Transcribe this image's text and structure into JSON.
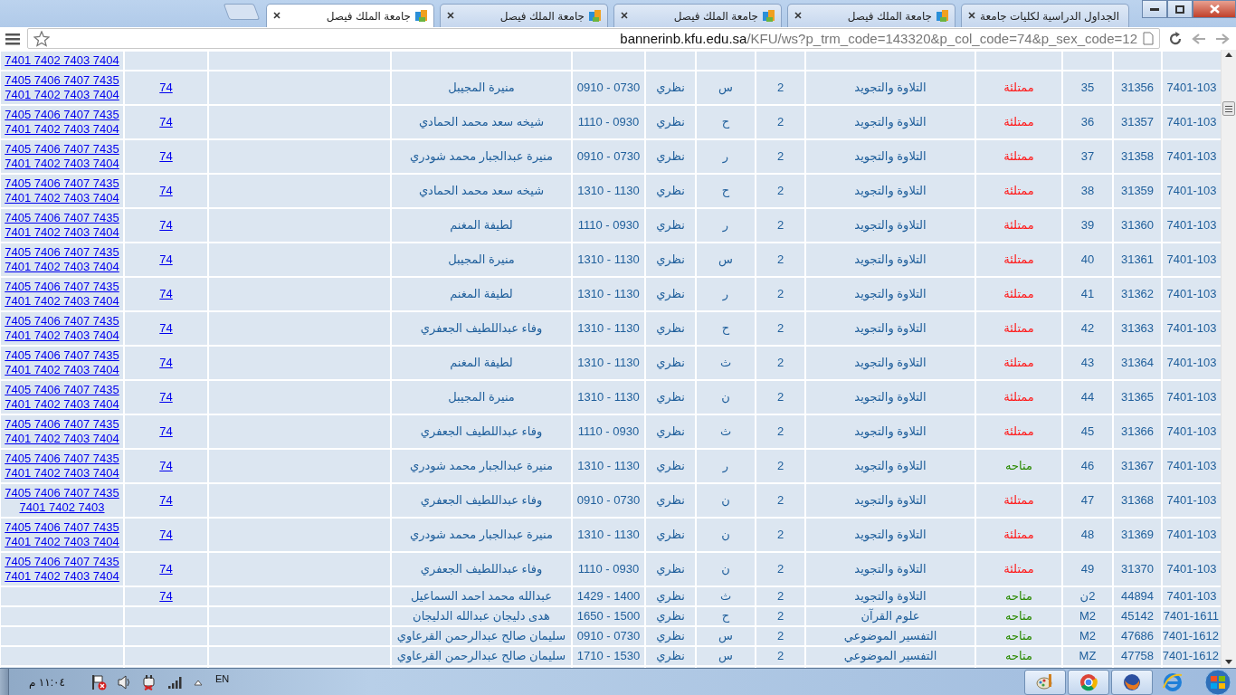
{
  "browser": {
    "tabs": [
      {
        "title": "الجداول الدراسية لكليات جامعة",
        "selected": false,
        "kind": "kfu"
      },
      {
        "title": "جامعة الملك فيصل",
        "selected": false,
        "kind": "site"
      },
      {
        "title": "جامعة الملك فيصل",
        "selected": false,
        "kind": "site"
      },
      {
        "title": "جامعة الملك فيصل",
        "selected": false,
        "kind": "site"
      },
      {
        "title": "جامعة الملك فيصل",
        "selected": true,
        "kind": "site"
      }
    ],
    "address_bar": {
      "host": "bannerinb.kfu.edu.sa",
      "path": "/KFU/ws?p_trm_code=143320&p_col_code=74&p_sex_code=12"
    }
  },
  "table": {
    "rows": [
      {
        "majors": [
          "7401 7402 7403 7404"
        ]
      },
      {
        "code": "7401-103",
        "crn": "31356",
        "section": "35",
        "status": "ممتلئة",
        "full": true,
        "course": "التلاوة والتجويد",
        "hours": "2",
        "day": "س",
        "type": "نظري",
        "time": "0910 - 0730",
        "instructor": "منيرة المجيبل",
        "college": "74",
        "majors": [
          "7405 7406 7407 7435",
          "7401 7402 7403 7404"
        ]
      },
      {
        "code": "7401-103",
        "crn": "31357",
        "section": "36",
        "status": "ممتلئة",
        "full": true,
        "course": "التلاوة والتجويد",
        "hours": "2",
        "day": "ح",
        "type": "نظري",
        "time": "1110 - 0930",
        "instructor": "شيخه سعد محمد الحمادي",
        "college": "74",
        "majors": [
          "7405 7406 7407 7435",
          "7401 7402 7403 7404"
        ]
      },
      {
        "code": "7401-103",
        "crn": "31358",
        "section": "37",
        "status": "ممتلئة",
        "full": true,
        "course": "التلاوة والتجويد",
        "hours": "2",
        "day": "ر",
        "type": "نظري",
        "time": "0910 - 0730",
        "instructor": "منيرة عبدالجبار محمد شودري",
        "college": "74",
        "majors": [
          "7405 7406 7407 7435",
          "7401 7402 7403 7404"
        ]
      },
      {
        "code": "7401-103",
        "crn": "31359",
        "section": "38",
        "status": "ممتلئة",
        "full": true,
        "course": "التلاوة والتجويد",
        "hours": "2",
        "day": "ح",
        "type": "نظري",
        "time": "1310 - 1130",
        "instructor": "شيخه سعد محمد الحمادي",
        "college": "74",
        "majors": [
          "7405 7406 7407 7435",
          "7401 7402 7403 7404"
        ]
      },
      {
        "code": "7401-103",
        "crn": "31360",
        "section": "39",
        "status": "ممتلئة",
        "full": true,
        "course": "التلاوة والتجويد",
        "hours": "2",
        "day": "ر",
        "type": "نظري",
        "time": "1110 - 0930",
        "instructor": "لطيفة المغنم",
        "college": "74",
        "majors": [
          "7405 7406 7407 7435",
          "7401 7402 7403 7404"
        ]
      },
      {
        "code": "7401-103",
        "crn": "31361",
        "section": "40",
        "status": "ممتلئة",
        "full": true,
        "course": "التلاوة والتجويد",
        "hours": "2",
        "day": "س",
        "type": "نظري",
        "time": "1310 - 1130",
        "instructor": "منيرة المجيبل",
        "college": "74",
        "majors": [
          "7405 7406 7407 7435",
          "7401 7402 7403 7404"
        ]
      },
      {
        "code": "7401-103",
        "crn": "31362",
        "section": "41",
        "status": "ممتلئة",
        "full": true,
        "course": "التلاوة والتجويد",
        "hours": "2",
        "day": "ر",
        "type": "نظري",
        "time": "1310 - 1130",
        "instructor": "لطيفة المغنم",
        "college": "74",
        "majors": [
          "7405 7406 7407 7435",
          "7401 7402 7403 7404"
        ]
      },
      {
        "code": "7401-103",
        "crn": "31363",
        "section": "42",
        "status": "ممتلئة",
        "full": true,
        "course": "التلاوة والتجويد",
        "hours": "2",
        "day": "ح",
        "type": "نظري",
        "time": "1310 - 1130",
        "instructor": "وفاء عبداللطيف الجعفري",
        "college": "74",
        "majors": [
          "7405 7406 7407 7435",
          "7401 7402 7403 7404"
        ]
      },
      {
        "code": "7401-103",
        "crn": "31364",
        "section": "43",
        "status": "ممتلئة",
        "full": true,
        "course": "التلاوة والتجويد",
        "hours": "2",
        "day": "ث",
        "type": "نظري",
        "time": "1310 - 1130",
        "instructor": "لطيفة المغنم",
        "college": "74",
        "majors": [
          "7405 7406 7407 7435",
          "7401 7402 7403 7404"
        ]
      },
      {
        "code": "7401-103",
        "crn": "31365",
        "section": "44",
        "status": "ممتلئة",
        "full": true,
        "course": "التلاوة والتجويد",
        "hours": "2",
        "day": "ن",
        "type": "نظري",
        "time": "1310 - 1130",
        "instructor": "منيرة المجيبل",
        "college": "74",
        "majors": [
          "7405 7406 7407 7435",
          "7401 7402 7403 7404"
        ]
      },
      {
        "code": "7401-103",
        "crn": "31366",
        "section": "45",
        "status": "ممتلئة",
        "full": true,
        "course": "التلاوة والتجويد",
        "hours": "2",
        "day": "ث",
        "type": "نظري",
        "time": "1110 - 0930",
        "instructor": "وفاء عبداللطيف الجعفري",
        "college": "74",
        "majors": [
          "7405 7406 7407 7435",
          "7401 7402 7403 7404"
        ]
      },
      {
        "code": "7401-103",
        "crn": "31367",
        "section": "46",
        "status": "متاحه",
        "full": false,
        "course": "التلاوة والتجويد",
        "hours": "2",
        "day": "ر",
        "type": "نظري",
        "time": "1310 - 1130",
        "instructor": "منيرة عبدالجبار محمد شودري",
        "college": "74",
        "majors": [
          "7405 7406 7407 7435",
          "7401 7402 7403 7404"
        ]
      },
      {
        "code": "7401-103",
        "crn": "31368",
        "section": "47",
        "status": "ممتلئة",
        "full": true,
        "course": "التلاوة والتجويد",
        "hours": "2",
        "day": "ن",
        "type": "نظري",
        "time": "0910 - 0730",
        "instructor": "وفاء عبداللطيف الجعفري",
        "college": "74",
        "majors": [
          "7405 7406 7407 7435",
          "7401 7402 7403"
        ]
      },
      {
        "code": "7401-103",
        "crn": "31369",
        "section": "48",
        "status": "ممتلئة",
        "full": true,
        "course": "التلاوة والتجويد",
        "hours": "2",
        "day": "ن",
        "type": "نظري",
        "time": "1310 - 1130",
        "instructor": "منيرة عبدالجبار محمد شودري",
        "college": "74",
        "majors": [
          "7405 7406 7407 7435",
          "7401 7402 7403 7404"
        ]
      },
      {
        "code": "7401-103",
        "crn": "31370",
        "section": "49",
        "status": "ممتلئة",
        "full": true,
        "course": "التلاوة والتجويد",
        "hours": "2",
        "day": "ن",
        "type": "نظري",
        "time": "1110 - 0930",
        "instructor": "وفاء عبداللطيف الجعفري",
        "college": "74",
        "majors": [
          "7405 7406 7407 7435",
          "7401 7402 7403 7404"
        ]
      },
      {
        "code": "7401-103",
        "crn": "44894",
        "section": "ن2",
        "status": "متاحه",
        "full": false,
        "course": "التلاوة والتجويد",
        "hours": "2",
        "day": "ث",
        "type": "نظري",
        "time": "1429 - 1400",
        "instructor": "عبدالله محمد احمد السماعيل",
        "college": "74"
      },
      {
        "code": "7401-1611",
        "crn": "45142",
        "section": "M2",
        "status": "متاحه",
        "full": false,
        "course": "علوم القرآن",
        "hours": "2",
        "day": "ح",
        "type": "نظري",
        "time": "1650 - 1500",
        "instructor": "هدى دليجان عبدالله الدليجان"
      },
      {
        "code": "7401-1612",
        "crn": "47686",
        "section": "M2",
        "status": "متاحه",
        "full": false,
        "course": "التفسير الموضوعي",
        "hours": "2",
        "day": "س",
        "type": "نظري",
        "time": "0910 - 0730",
        "instructor": "سليمان صالح عبدالرحمن القرعاوي"
      },
      {
        "code": "7401-1612",
        "crn": "47758",
        "section": "MZ",
        "status": "متاحه",
        "full": false,
        "course": "التفسير الموضوعي",
        "hours": "2",
        "day": "س",
        "type": "نظري",
        "time": "1710 - 1530",
        "instructor": "سليمان صالح عبدالرحمن القرعاوي"
      }
    ]
  },
  "taskbar": {
    "language": "EN",
    "clock": "١١:٠٤ م"
  }
}
